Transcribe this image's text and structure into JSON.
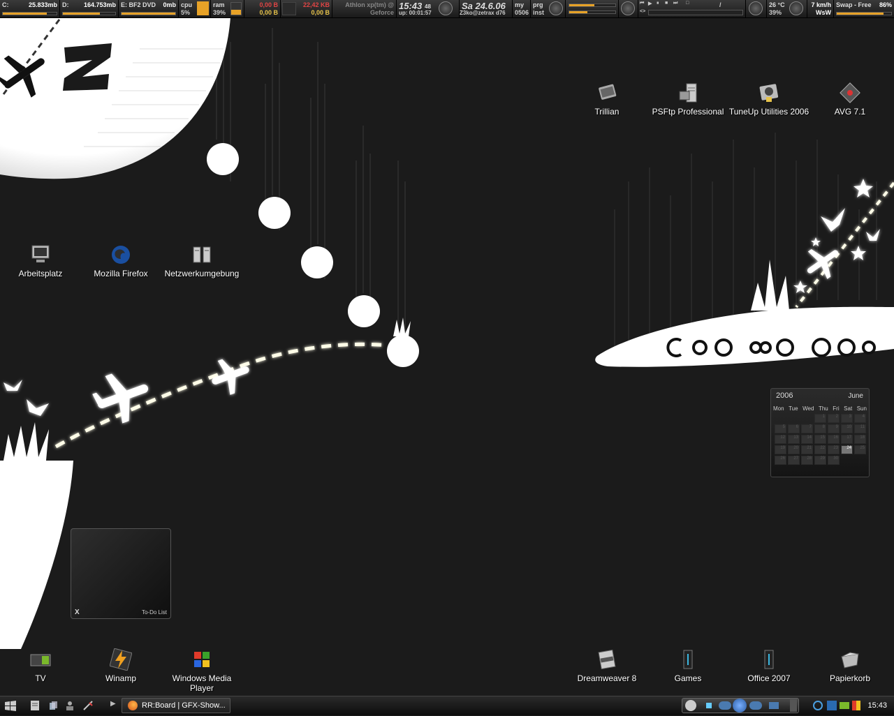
{
  "topbar": {
    "drive_c": {
      "label": "C:",
      "value": "25.833mb"
    },
    "drive_d": {
      "label": "D:",
      "value": "164.753mb"
    },
    "drive_e": {
      "label": "E: BF2 DVD",
      "value": "0mb"
    },
    "cpu": {
      "label": "cpu",
      "value": "5%",
      "fraction": 0.05
    },
    "ram": {
      "label": "ram",
      "value": "39%",
      "fraction": 0.39
    },
    "net_up": {
      "line1": "0,00 B",
      "line2": "0,00 B"
    },
    "net_down": {
      "line1": "22,42 KB",
      "line2": "0,00 B"
    },
    "hw": {
      "line1": "Athlon xp(tm) @",
      "line2": "Geforce"
    },
    "time": {
      "clock": "15:43",
      "seconds": "48",
      "uptime": "up: 00:01:57"
    },
    "date": {
      "text": "Sa  24.6.06",
      "user": "Z3ko@zetrax d76"
    },
    "my": {
      "label": "my",
      "value": "0506"
    },
    "prg": {
      "label": "prg",
      "value": "inst"
    },
    "player_marker": "/",
    "weather": {
      "temp": "26 °C",
      "humidity": "39%",
      "wind": "7 km/h",
      "dir": "WsW"
    },
    "swap": {
      "label": "Swap - Free",
      "value": "86%",
      "fraction": 0.86
    }
  },
  "desktop_icons": [
    {
      "name": "Trillian",
      "icon": "trillian-icon"
    },
    {
      "name": "PSFtp Professional",
      "icon": "server-icon"
    },
    {
      "name": "TuneUp Utilities 2006",
      "icon": "tuneup-icon"
    },
    {
      "name": "AVG 7.1",
      "icon": "avg-icon"
    },
    {
      "name": "Arbeitsplatz",
      "icon": "computer-icon"
    },
    {
      "name": "Mozilla Firefox",
      "icon": "globe-icon"
    },
    {
      "name": "Netzwerkumgebung",
      "icon": "network-icon"
    },
    {
      "name": "TV",
      "icon": "tv-icon"
    },
    {
      "name": "Winamp",
      "icon": "winamp-icon"
    },
    {
      "name": "Windows Media Player",
      "icon": "media-player-icon"
    },
    {
      "name": "Dreamweaver 8",
      "icon": "html-file-icon"
    },
    {
      "name": "Games",
      "icon": "folder-icon"
    },
    {
      "name": "Office 2007",
      "icon": "folder-icon"
    },
    {
      "name": "Papierkorb",
      "icon": "recycle-bin-icon"
    }
  ],
  "calendar": {
    "year": "2006",
    "month": "June",
    "weekdays": [
      "Mon",
      "Tue",
      "Wed",
      "Thu",
      "Fri",
      "Sat",
      "Sun"
    ],
    "first_weekday_index": 3,
    "days_in_month": 30,
    "today": 24
  },
  "todo": {
    "close": "X",
    "title": "To-Do List"
  },
  "taskbar": {
    "task_button": "RR:Board | GFX-Show...",
    "clock": "15:43"
  },
  "colors": {
    "accent": "#e7a227",
    "background": "#1b1b1b",
    "net_red": "#e04444"
  }
}
